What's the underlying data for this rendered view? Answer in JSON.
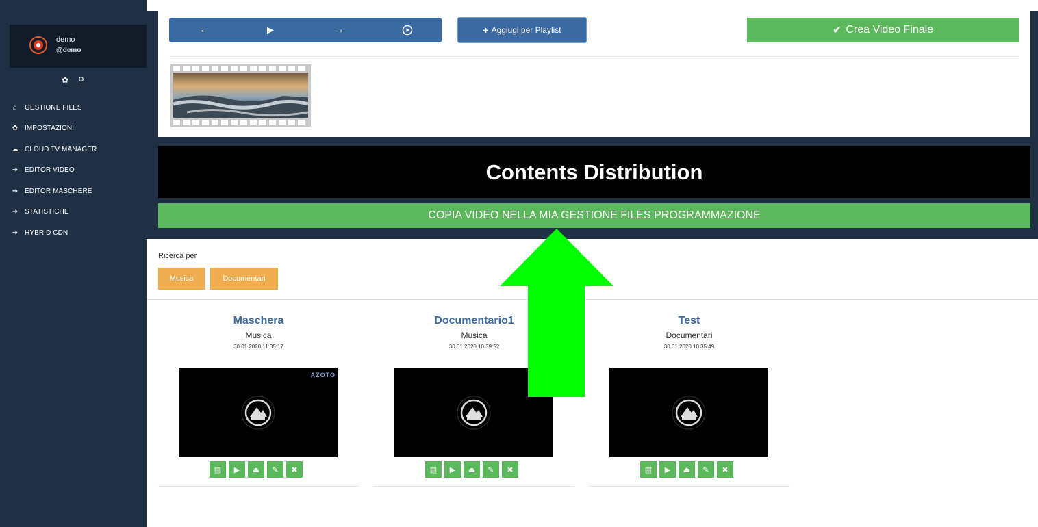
{
  "user": {
    "name": "demo",
    "handle": "@demo"
  },
  "sidebar": {
    "items": [
      {
        "label": "GESTIONE FILES",
        "icon": "home-icon",
        "glyph": "⌂"
      },
      {
        "label": "IMPOSTAZIONI",
        "icon": "gear-icon",
        "glyph": "✿"
      },
      {
        "label": "CLOUD TV MANAGER",
        "icon": "cloud-icon",
        "glyph": "☁"
      },
      {
        "label": "EDITOR VIDEO",
        "icon": "arrow-right-icon",
        "glyph": "➜"
      },
      {
        "label": "EDITOR MASCHERE",
        "icon": "arrow-right-icon",
        "glyph": "➜"
      },
      {
        "label": "STATISTICHE",
        "icon": "arrow-right-icon",
        "glyph": "➜"
      },
      {
        "label": "HYBRID CDN",
        "icon": "arrow-right-icon",
        "glyph": "➜"
      }
    ]
  },
  "toolbar": {
    "playlist_label": "Aggiugi per Playlist",
    "final_label": "Crea Video Finale"
  },
  "banner": {
    "title": "Contents Distribution",
    "copy_label": "COPIA VIDEO NELLA MIA GESTIONE FILES PROGRAMMAZIONE"
  },
  "search": {
    "label": "Ricerca per",
    "tags": [
      "Musica",
      "Documentari"
    ]
  },
  "cards": [
    {
      "title": "Maschera",
      "category": "Musica",
      "date": "30.01.2020 11:35:17",
      "brand": "AZOTO"
    },
    {
      "title": "Documentario1",
      "category": "Musica",
      "date": "30.01.2020 10:39:52",
      "brand": ""
    },
    {
      "title": "Test",
      "category": "Documentari",
      "date": "30.01.2020 10:35:49",
      "brand": ""
    }
  ],
  "colors": {
    "sidebar": "#1f3044",
    "primary": "#3b6aa3",
    "success": "#5cb85c",
    "warning": "#f0ad4e",
    "arrow": "#00ff00"
  }
}
